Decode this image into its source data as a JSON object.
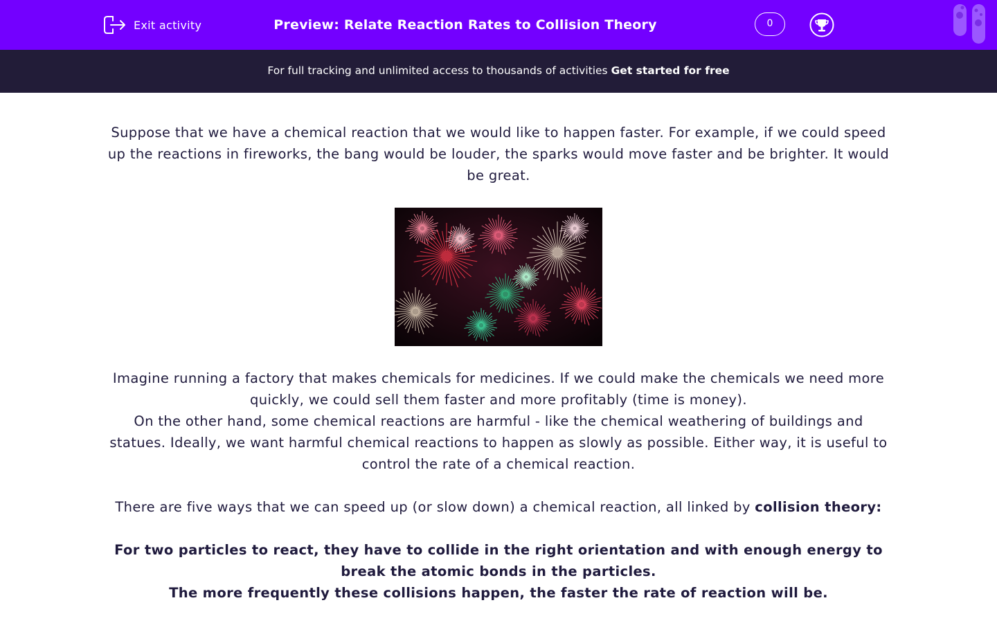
{
  "header": {
    "exit_label": "Exit activity",
    "title": "Preview: Relate Reaction Rates to Collision Theory",
    "score": "0",
    "accent_color": "#7300ff"
  },
  "banner": {
    "text": "For full tracking and unlimited access to thousands of activities ",
    "cta": "Get started for free",
    "background": "#221c38"
  },
  "content": {
    "para1": "Suppose that we have a chemical reaction that we would like to happen faster. For example, if we could speed up the reactions in fireworks, the bang would be louder, the sparks would move faster and be brighter. It would be great.",
    "image_alt": "fireworks",
    "para2a": "Imagine running a factory that makes chemicals for medicines. If we could make the chemicals we need more quickly, we could sell them faster and more profitably (time is money).",
    "para2b": "On the other hand, some chemical reactions are harmful - like the chemical weathering of buildings and statues. Ideally, we want harmful chemical reactions to happen as slowly as possible. Either way, it is useful to control the rate of a chemical reaction.",
    "para3_text": "There are five ways that we can speed up (or slow down) a chemical reaction, all linked by ",
    "para3_bold": "collision theory:",
    "para4a": "For two particles to react, they have to collide in the right orientation and with enough energy to break the atomic bonds in the particles.",
    "para4b": "The more frequently these collisions happen, the faster the rate of reaction will be."
  },
  "icons": {
    "exit": "exit-icon",
    "trophy": "trophy-icon",
    "tubes": "test-tubes-icon"
  }
}
